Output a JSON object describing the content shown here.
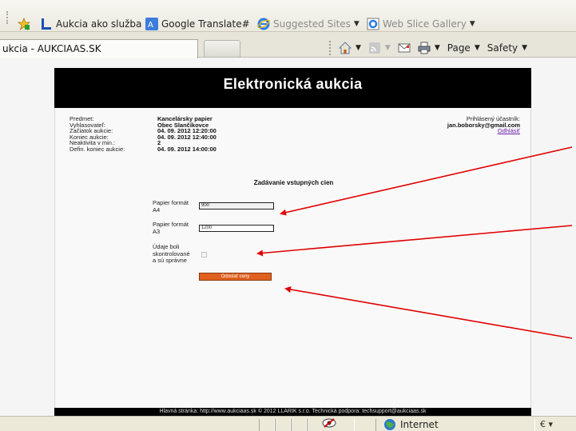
{
  "favorites_bar": {
    "items": [
      {
        "label": "Aukcia ako služba",
        "icon": "page-icon"
      },
      {
        "label": "Google Translate#",
        "icon": "translate-icon"
      },
      {
        "label": "Suggested Sites",
        "icon": "ie-icon",
        "has_dropdown": true
      },
      {
        "label": "Web Slice Gallery",
        "icon": "webslice-icon",
        "has_dropdown": true
      }
    ]
  },
  "tab": {
    "title": "ukcia - AUKCIAAS.SK"
  },
  "command_bar": {
    "page_label": "Page",
    "safety_label": "Safety"
  },
  "page": {
    "title": "Elektronická aukcia",
    "info_labels": [
      "Predmet:",
      "Vyhlasovateľ:",
      "Začiatok aukcie:",
      "Koniec aukcie:",
      "Neaktivita v min.:",
      "Defin. koniec aukcie:"
    ],
    "info_values": [
      "Kancelársky papier",
      "Obec Slančíkovce",
      "04. 09. 2012 12:20:00",
      "04. 09. 2012 12:40:00",
      "2",
      "04. 09. 2012 14:00:00"
    ],
    "user": {
      "caption": "Prihlásený účastník:",
      "email": "jan.boborsky@gmail.com",
      "logout": "Odhlásiť"
    },
    "form": {
      "title": "Zadávanie vstupných cien",
      "field1_label_line1": "Papier formát",
      "field1_label_line2": "A4",
      "field1_value": "900",
      "field2_label_line1": "Papier formát",
      "field2_label_line2": "A3",
      "field2_value": "1200",
      "confirm_line1": "Údaje boli",
      "confirm_line2": "skontrolované",
      "confirm_line3": "a sú správne",
      "submit_label": "Odoslať ceny"
    },
    "footer": "Hlavná stránka: http://www.aukciaas.sk © 2012 LLARIK s.r.o. Technická podpora: techsupport@aukciaas.sk"
  },
  "status_bar": {
    "zone": "Internet",
    "zoom": "€"
  },
  "colors": {
    "annotation_arrow": "#e00000",
    "submit_button": "#e0601f",
    "header_bg": "#000000",
    "logout_link": "#6a1ca8"
  }
}
